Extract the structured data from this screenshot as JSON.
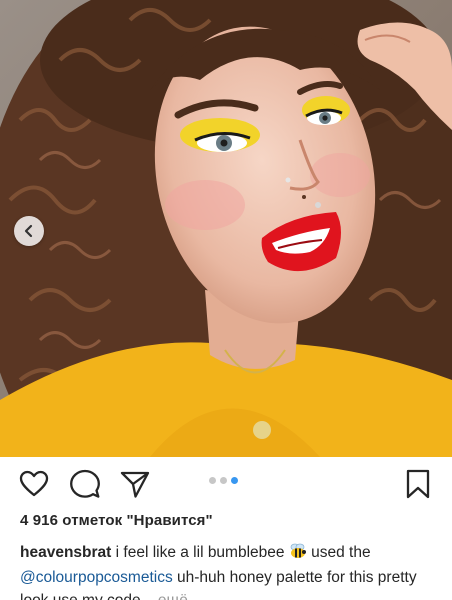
{
  "post": {
    "likes_text": "4 916 отметок \"Нравится\"",
    "carousel": {
      "count": 3,
      "active_index": 2
    }
  },
  "caption": {
    "username": "heavensbrat",
    "text_part1": "i feel like a lil bumblebee",
    "text_part2": "used the",
    "mention": "@colourpopcosmetics",
    "text_part3": "uh-huh honey palette for this pretty look use my code...",
    "more_label": "ещё"
  },
  "icons": {
    "prev": "chevron-left-icon",
    "like": "heart-icon",
    "comment": "comment-icon",
    "share": "paper-plane-icon",
    "save": "bookmark-icon",
    "emoji": "bee-emoji-icon"
  },
  "colors": {
    "accent_dot": "#3897f0",
    "lipstick": "#e0141e",
    "eyeshadow": "#f2d32a",
    "sweater": "#f2b31a"
  }
}
